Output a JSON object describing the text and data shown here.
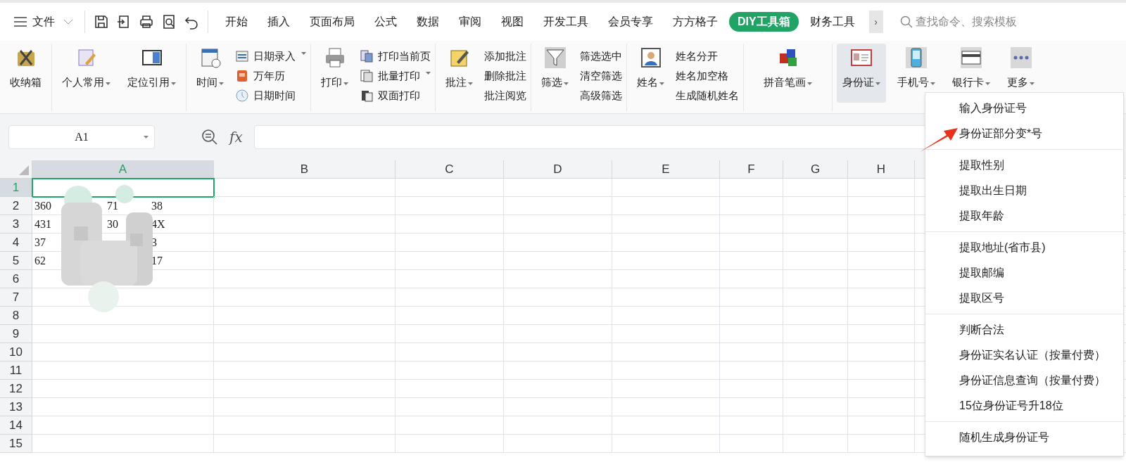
{
  "file_menu": {
    "label": "文件"
  },
  "tabs": [
    {
      "label": "开始",
      "selected": false
    },
    {
      "label": "插入",
      "selected": false
    },
    {
      "label": "页面布局",
      "selected": false
    },
    {
      "label": "公式",
      "selected": false
    },
    {
      "label": "数据",
      "selected": false
    },
    {
      "label": "审阅",
      "selected": false
    },
    {
      "label": "视图",
      "selected": false
    },
    {
      "label": "开发工具",
      "selected": false
    },
    {
      "label": "会员专享",
      "selected": false
    },
    {
      "label": "方方格子",
      "selected": false
    },
    {
      "label": "DIY工具箱",
      "selected": true
    },
    {
      "label": "财务工具",
      "selected": false
    }
  ],
  "tab_scroll": "›",
  "search": {
    "placeholder": "查找命令、搜索模板"
  },
  "ribbon_groups": [
    {
      "items": [
        {
          "kind": "large",
          "label": "收纳箱",
          "dropdown": false,
          "pressed": false
        }
      ]
    },
    {
      "items": [
        {
          "kind": "large",
          "label": "个人常用",
          "dropdown": true,
          "pressed": false
        },
        {
          "kind": "large",
          "label": "定位引用",
          "dropdown": true,
          "pressed": false
        }
      ]
    },
    {
      "items": [
        {
          "kind": "large",
          "label": "时间",
          "dropdown": true,
          "pressed": false
        },
        {
          "kind": "column",
          "entries": [
            {
              "label": "日期录入",
              "dropdown": true
            },
            {
              "label": "万年历",
              "dropdown": false
            },
            {
              "label": "日期时间",
              "dropdown": false
            }
          ]
        }
      ]
    },
    {
      "items": [
        {
          "kind": "large",
          "label": "打印",
          "dropdown": true,
          "pressed": false
        },
        {
          "kind": "column",
          "entries": [
            {
              "label": "打印当前页",
              "dropdown": false
            },
            {
              "label": "批量打印",
              "dropdown": true
            },
            {
              "label": "双面打印",
              "dropdown": false
            }
          ]
        }
      ]
    },
    {
      "items": [
        {
          "kind": "large",
          "label": "批注",
          "dropdown": true,
          "pressed": false
        },
        {
          "kind": "column",
          "entries": [
            {
              "label": "添加批注",
              "dropdown": false
            },
            {
              "label": "删除批注",
              "dropdown": false
            },
            {
              "label": "批注阅览",
              "dropdown": false
            }
          ]
        }
      ]
    },
    {
      "items": [
        {
          "kind": "large",
          "label": "筛选",
          "dropdown": true,
          "pressed": false
        },
        {
          "kind": "column",
          "entries": [
            {
              "label": "筛选选中",
              "dropdown": false
            },
            {
              "label": "清空筛选",
              "dropdown": false
            },
            {
              "label": "高级筛选",
              "dropdown": false
            }
          ]
        }
      ]
    },
    {
      "items": [
        {
          "kind": "large",
          "label": "姓名",
          "dropdown": true,
          "pressed": false
        },
        {
          "kind": "column",
          "entries": [
            {
              "label": "姓名分开",
              "dropdown": false
            },
            {
              "label": "姓名加空格",
              "dropdown": false
            },
            {
              "label": "生成随机姓名",
              "dropdown": false
            }
          ]
        }
      ]
    },
    {
      "items": [
        {
          "kind": "large",
          "label": "拼音笔画",
          "dropdown": true,
          "pressed": false
        }
      ]
    },
    {
      "items": [
        {
          "kind": "large",
          "label": "身份证",
          "dropdown": true,
          "pressed": true
        },
        {
          "kind": "large",
          "label": "手机号",
          "dropdown": true,
          "pressed": false
        },
        {
          "kind": "large",
          "label": "银行卡",
          "dropdown": true,
          "pressed": false
        },
        {
          "kind": "large",
          "label": "更多",
          "dropdown": true,
          "pressed": false
        }
      ]
    }
  ],
  "name_box": {
    "value": "A1"
  },
  "formula_bar": {
    "fx": "fx"
  },
  "columns": [
    {
      "label": "A",
      "selected": true
    },
    {
      "label": "B",
      "selected": false
    },
    {
      "label": "C",
      "selected": false
    },
    {
      "label": "D",
      "selected": false
    },
    {
      "label": "E",
      "selected": false
    },
    {
      "label": "F",
      "selected": false
    },
    {
      "label": "G",
      "selected": false
    },
    {
      "label": "H",
      "selected": false
    }
  ],
  "rows": [
    {
      "label": "1",
      "selected": true,
      "segments": []
    },
    {
      "label": "2",
      "selected": false,
      "segments": [
        "360",
        "71",
        "38"
      ]
    },
    {
      "label": "3",
      "selected": false,
      "segments": [
        "431",
        "30",
        "4X"
      ]
    },
    {
      "label": "4",
      "selected": false,
      "segments": [
        "37",
        "3"
      ]
    },
    {
      "label": "5",
      "selected": false,
      "segments": [
        "62",
        "17"
      ]
    },
    {
      "label": "6",
      "selected": false,
      "segments": []
    },
    {
      "label": "7",
      "selected": false,
      "segments": []
    },
    {
      "label": "8",
      "selected": false,
      "segments": []
    },
    {
      "label": "9",
      "selected": false,
      "segments": []
    },
    {
      "label": "10",
      "selected": false,
      "segments": []
    },
    {
      "label": "11",
      "selected": false,
      "segments": []
    },
    {
      "label": "12",
      "selected": false,
      "segments": []
    },
    {
      "label": "13",
      "selected": false,
      "segments": []
    },
    {
      "label": "14",
      "selected": false,
      "segments": []
    },
    {
      "label": "15",
      "selected": false,
      "segments": []
    }
  ],
  "id_menu": {
    "sections": [
      [
        "输入身份证号",
        "身份证部分变*号"
      ],
      [
        "提取性别",
        "提取出生日期",
        "提取年龄"
      ],
      [
        "提取地址(省市县)",
        "提取邮编",
        "提取区号"
      ],
      [
        "判断合法",
        "身份证实名认证（按量付费）",
        "身份证信息查询（按量付费）",
        "15位身份证号升18位"
      ],
      [
        "随机生成身份证号"
      ]
    ]
  }
}
